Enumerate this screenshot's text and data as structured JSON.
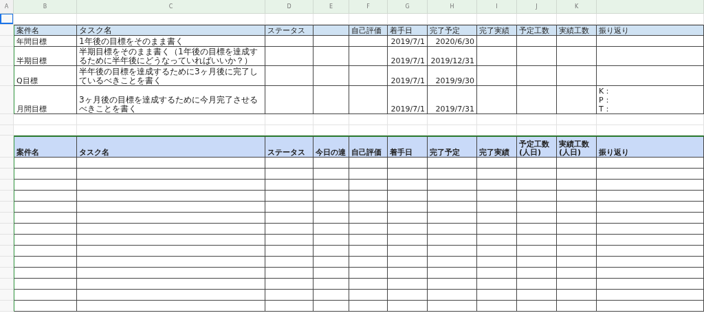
{
  "column_headers": [
    "A",
    "B",
    "C",
    "D",
    "E",
    "F",
    "G",
    "H",
    "I",
    "J",
    "K"
  ],
  "goals_table": {
    "header": {
      "B": "案件名",
      "C": "タスク名",
      "D": "ステータス",
      "F": "自己評価",
      "G": "着手日",
      "H": "完了予定",
      "I": "完了実績",
      "J": "予定工数",
      "K": "実績工数",
      "L": "振り返り"
    },
    "rows": [
      {
        "B": "年間目標",
        "C": "1年後の目標をそのまま書く",
        "G": "2019/7/1",
        "H": "2020/6/30"
      },
      {
        "B": "半期目標",
        "C": "半期目標をそのまま書く（1年後の目標を達成するために半年後にどうなっていればいいか？）",
        "G": "2019/7/1",
        "H": "2019/12/31"
      },
      {
        "B": "Q目標",
        "C": "半年後の目標を達成するために3ヶ月後に完了しているべきことを書く",
        "G": "2019/7/1",
        "H": "2019/9/30"
      },
      {
        "B": "月間目標",
        "C": "3ヶ月後の目標を達成するために今月完了させるべきことを書く",
        "G": "2019/7/1",
        "H": "2019/7/31",
        "L": "K：\nP：\nT："
      }
    ]
  },
  "task_table": {
    "header": {
      "B": "案件名",
      "C": "タスク名",
      "D": "ステータス",
      "E": "今日の達",
      "F": "自己評価",
      "G": "着手日",
      "H": "完了予定",
      "I": "完了実績",
      "J": "予定工数\n(人日)",
      "K": "実績工数\n(人日)",
      "L": "振り返り"
    }
  }
}
